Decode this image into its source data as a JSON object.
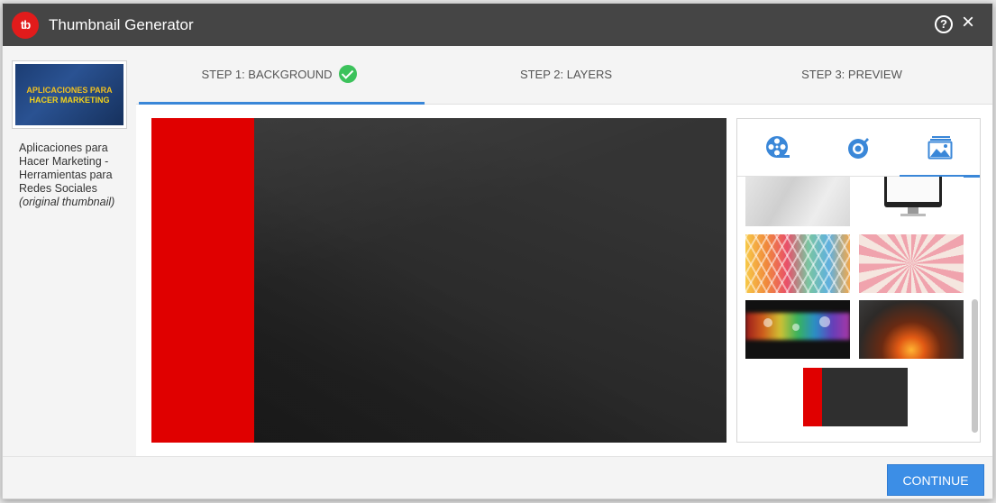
{
  "app": {
    "logo_text": "tb",
    "title": "Thumbnail Generator"
  },
  "header": {
    "help_icon": "question-circle-icon",
    "help_glyph": "?",
    "close_icon": "close-icon",
    "close_glyph": "×"
  },
  "sidebar": {
    "thumb_line1": "APLICACIONES PARA",
    "thumb_line2": "HACER MARKETING",
    "caption": "Aplicaciones para Hacer Marketing - Herramientas para Redes Sociales",
    "note": "(original thumbnail)"
  },
  "steps": [
    {
      "label": "STEP 1: BACKGROUND",
      "completed": true,
      "active": true
    },
    {
      "label": "STEP 2: LAYERS",
      "completed": false,
      "active": false
    },
    {
      "label": "STEP 3: PREVIEW",
      "completed": false,
      "active": false
    }
  ],
  "panel": {
    "tabs": [
      {
        "icon": "film-reel-icon",
        "active": false
      },
      {
        "icon": "brush-target-icon",
        "active": false
      },
      {
        "icon": "image-gallery-icon",
        "active": true
      }
    ],
    "backgrounds": [
      {
        "name": "paper-texture",
        "selected": false
      },
      {
        "name": "computer-monitor",
        "selected": false
      },
      {
        "name": "colorful-leaves",
        "selected": false
      },
      {
        "name": "pink-sunburst",
        "selected": false
      },
      {
        "name": "rainbow-bokeh",
        "selected": false
      },
      {
        "name": "fire-smoke",
        "selected": false
      },
      {
        "name": "red-stripe-dark",
        "selected": true
      }
    ]
  },
  "colors": {
    "accent": "#3a87d8",
    "brand_red": "#e21b1b",
    "success": "#3cc25b",
    "titlebar": "#454545"
  },
  "footer": {
    "continue_label": "CONTINUE"
  }
}
